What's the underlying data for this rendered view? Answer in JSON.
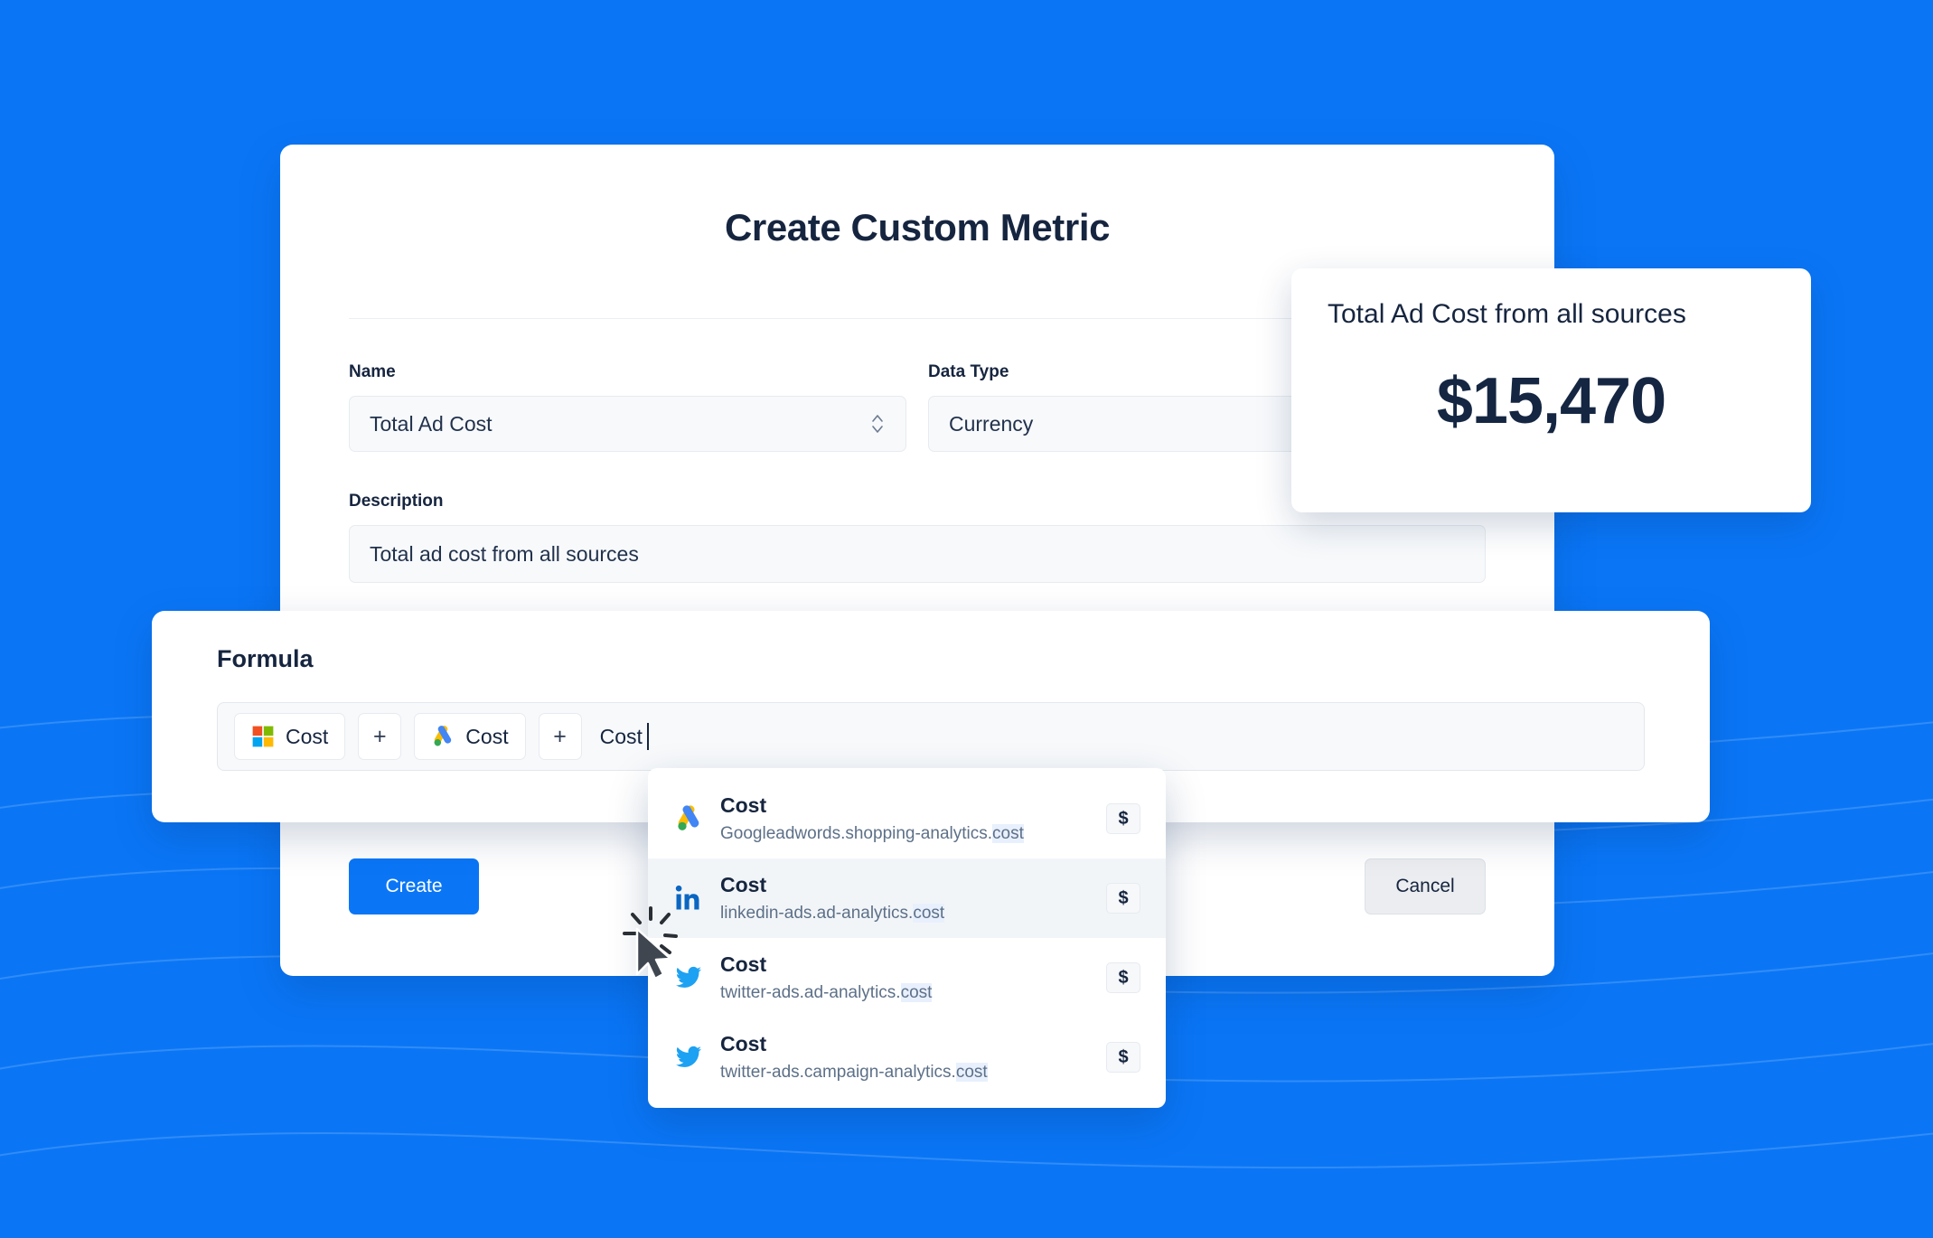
{
  "theme": {
    "background_blue": "#0a76f6",
    "accent_blue": "#0a76f6",
    "text_dark": "#16253f",
    "muted_text": "#5d7088",
    "field_bg": "#f7f9fb",
    "cancel_bg": "#ebedf0",
    "highlight_bg": "#e8f0fd"
  },
  "modal": {
    "title": "Create Custom Metric",
    "fields": {
      "name": {
        "label": "Name",
        "value": "Total Ad Cost",
        "icon": "stepper-chevrons-icon"
      },
      "data_type": {
        "label": "Data Type",
        "value": "Currency"
      },
      "description": {
        "label": "Description",
        "value": "Total ad cost from all sources"
      }
    },
    "footer": {
      "create_label": "Create",
      "cancel_label": "Cancel"
    }
  },
  "preview_card": {
    "title": "Total Ad Cost from all sources",
    "value": "$15,470"
  },
  "formula_panel": {
    "label": "Formula",
    "tokens": [
      {
        "kind": "chip",
        "icon": "microsoft-ads-icon",
        "label": "Cost"
      },
      {
        "kind": "operator",
        "label": "+"
      },
      {
        "kind": "chip",
        "icon": "google-ads-icon",
        "label": "Cost"
      },
      {
        "kind": "operator",
        "label": "+"
      }
    ],
    "typed_text": "Cost",
    "caret_visible": true
  },
  "suggestions": {
    "items": [
      {
        "icon": "google-ads-icon",
        "name": "Cost",
        "path_prefix": "Googleadwords.shopping-analytics.",
        "path_match": "cost",
        "badge": "$",
        "active": false
      },
      {
        "icon": "linkedin-icon",
        "name": "Cost",
        "path_prefix": "linkedin-ads.ad-analytics.",
        "path_match": "cost",
        "badge": "$",
        "active": true
      },
      {
        "icon": "twitter-icon",
        "name": "Cost",
        "path_prefix": "twitter-ads.ad-analytics.",
        "path_match": "cost",
        "badge": "$",
        "active": false
      },
      {
        "icon": "twitter-icon",
        "name": "Cost",
        "path_prefix": "twitter-ads.campaign-analytics.",
        "path_match": "cost",
        "badge": "$",
        "active": false
      }
    ]
  },
  "cursor": {
    "type": "click-cursor",
    "state": "clicking"
  }
}
